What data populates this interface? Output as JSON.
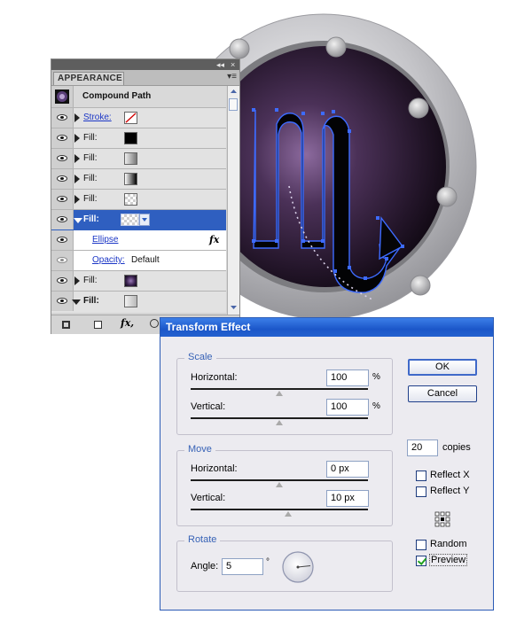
{
  "appearance_panel": {
    "tab_label": "APPEARANCE",
    "collapse_icon": "◂◂",
    "close_icon": "×",
    "menu_icon": "▾≡",
    "object_title": "Compound Path",
    "rows": [
      {
        "label": "Stroke:",
        "type": "stroke",
        "swatch": "none"
      },
      {
        "label": "Fill:",
        "type": "fill",
        "swatch": "#000000"
      },
      {
        "label": "Fill:",
        "type": "fill",
        "swatch": "gray-gradient"
      },
      {
        "label": "Fill:",
        "type": "fill",
        "swatch": "black-gradient"
      },
      {
        "label": "Fill:",
        "type": "fill",
        "swatch": "transparent-checker"
      },
      {
        "label": "Fill:",
        "type": "fill",
        "swatch": "transparent-checker",
        "selected": true
      },
      {
        "label": "Ellipse",
        "type": "effect",
        "fx": "fx"
      },
      {
        "label": "Opacity:",
        "value": "Default",
        "type": "opacity"
      },
      {
        "label": "Fill:",
        "type": "fill",
        "swatch": "purple-radial"
      },
      {
        "label": "Fill:",
        "type": "fill",
        "swatch": "light-gradient"
      }
    ],
    "bottom_fx": "fx,"
  },
  "dialog": {
    "title": "Transform Effect",
    "scale": {
      "title": "Scale",
      "horizontal_label": "Horizontal:",
      "horizontal_value": "100",
      "horizontal_unit": "%",
      "vertical_label": "Vertical:",
      "vertical_value": "100",
      "vertical_unit": "%"
    },
    "move": {
      "title": "Move",
      "horizontal_label": "Horizontal:",
      "horizontal_value": "0 px",
      "vertical_label": "Vertical:",
      "vertical_value": "10 px"
    },
    "rotate": {
      "title": "Rotate",
      "angle_label": "Angle:",
      "angle_value": "5",
      "angle_unit": "°"
    },
    "ok_label": "OK",
    "cancel_label": "Cancel",
    "copies_value": "20",
    "copies_label": "copies",
    "reflect_x_label": "Reflect X",
    "reflect_x_checked": false,
    "reflect_y_label": "Reflect Y",
    "reflect_y_checked": false,
    "random_label": "Random",
    "random_checked": false,
    "preview_label": "Preview",
    "preview_checked": true
  },
  "colors": {
    "accent": "#2f5fc0",
    "porthole_ring": "#b8b8bc",
    "porthole_inner": "#2a1a35",
    "path_highlight": "#3d6bff"
  }
}
